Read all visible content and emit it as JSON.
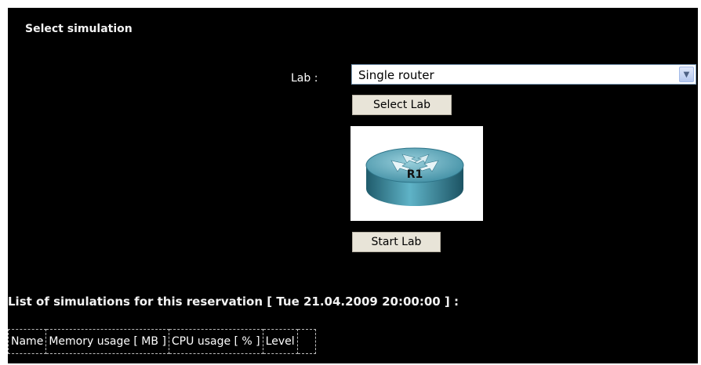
{
  "select_section": {
    "title": "Select simulation",
    "lab_label": "Lab :",
    "lab_value": "Single router",
    "select_button": "Select Lab",
    "start_button": "Start Lab"
  },
  "topology": {
    "router_label": "R1",
    "router_icon": "router-icon"
  },
  "simulations": {
    "title": "List of simulations for this reservation [ Tue 21.04.2009 20:00:00 ] :",
    "columns": [
      "Name",
      "Memory usage [ MB ]",
      "CPU usage [ % ]",
      "Level",
      ""
    ]
  },
  "colors": {
    "background": "#000000",
    "button_face": "#e8e4d8",
    "router_body": "#3d8fa3"
  }
}
